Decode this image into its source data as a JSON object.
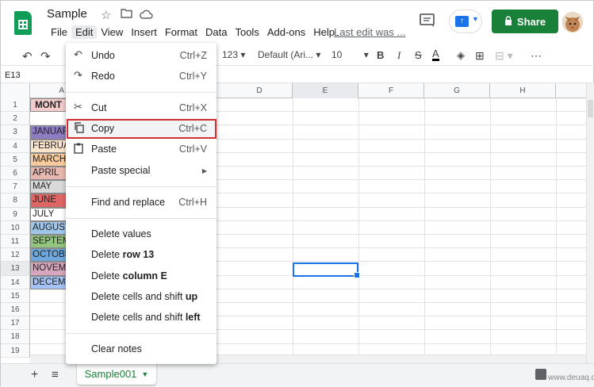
{
  "app": {
    "title": "Sample"
  },
  "header": {
    "menus": [
      "File",
      "Edit",
      "View",
      "Insert",
      "Format",
      "Data",
      "Tools",
      "Add-ons",
      "Help"
    ],
    "last_edit": "Last edit was ...",
    "share_label": "Share",
    "icons": [
      "star-icon",
      "move-folder-icon",
      "cloud-status-icon",
      "comments-icon",
      "present-icon"
    ]
  },
  "toolbar": {
    "number_format": "123",
    "font": "Default (Ari...",
    "font_size": "10",
    "bold": "B",
    "italic": "I",
    "strike": "S",
    "text_color": "A"
  },
  "formula_bar": {
    "name_box": "E13"
  },
  "grid": {
    "columns": [
      "A",
      "D",
      "E",
      "F",
      "G",
      "H"
    ],
    "rows": [
      "1",
      "2",
      "3",
      "4",
      "5",
      "6",
      "7",
      "8",
      "9",
      "10",
      "11",
      "12",
      "13",
      "14",
      "15",
      "16",
      "17",
      "18",
      "19"
    ],
    "header_cell": "MONT",
    "months": [
      "JANUAR",
      "FEBRUA",
      "MARCH",
      "APRIL",
      "MAY",
      "JUNE",
      "JULY",
      "AUGUST",
      "SEPTEM",
      "OCTOBE",
      "NOVEMB",
      "DECEMB"
    ],
    "month_colors": [
      "#8e7cc3",
      "#fce5cd",
      "#f9cb9c",
      "#e6b8af",
      "#d9d9d9",
      "#e06666",
      "#ffffff",
      "#9fc5e8",
      "#93c47d",
      "#6fa8dc",
      "#d5a6bd",
      "#a4c2f4"
    ],
    "selected_cell": "E13"
  },
  "edit_menu": {
    "items": [
      {
        "label": "Undo",
        "shortcut": "Ctrl+Z",
        "icon": "undo-icon"
      },
      {
        "label": "Redo",
        "shortcut": "Ctrl+Y",
        "icon": "redo-icon"
      },
      {
        "label": "Cut",
        "shortcut": "Ctrl+X",
        "icon": "scissors-icon"
      },
      {
        "label": "Copy",
        "shortcut": "Ctrl+C",
        "icon": "copy-icon"
      },
      {
        "label": "Paste",
        "shortcut": "Ctrl+V",
        "icon": "paste-icon"
      },
      {
        "label": "Paste special",
        "shortcut": "",
        "icon": ""
      },
      {
        "label": "Find and replace",
        "shortcut": "Ctrl+H",
        "icon": ""
      },
      {
        "label": "Delete values",
        "shortcut": "",
        "icon": ""
      },
      {
        "label_plain": "Delete ",
        "label_bold": "row 13"
      },
      {
        "label_plain": "Delete ",
        "label_bold": "column E"
      },
      {
        "label_plain": "Delete cells and shift ",
        "label_bold": "up"
      },
      {
        "label_plain": "Delete cells and shift ",
        "label_bold": "left"
      },
      {
        "label": "Clear notes",
        "shortcut": "",
        "icon": ""
      }
    ],
    "highlighted": "Copy"
  },
  "sheet_tabs": {
    "active": "Sample001"
  },
  "watermark": "www.deuaq.com"
}
